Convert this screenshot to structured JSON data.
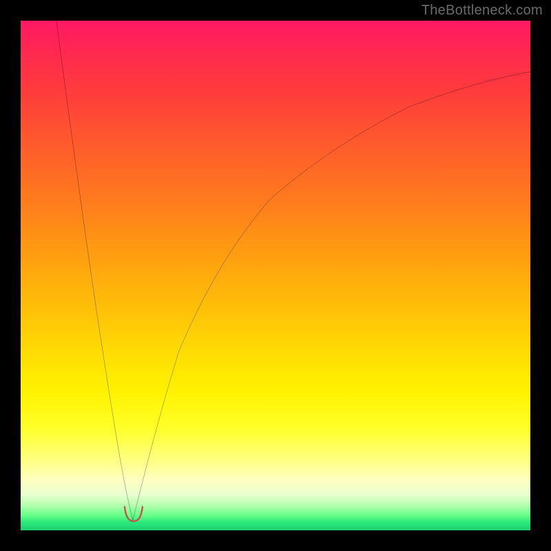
{
  "watermark": {
    "text": "TheBottleneck.com"
  },
  "colors": {
    "background": "#000000",
    "curve_main": "#000000",
    "marker": "#c1564e",
    "gradient_stops": [
      "#ff1864",
      "#ff2850",
      "#ff3c3c",
      "#ff5a2d",
      "#ff7a1e",
      "#ff9e10",
      "#ffbe08",
      "#ffdc04",
      "#fff300",
      "#ffff2a",
      "#ffff80",
      "#ffffc0",
      "#eaffd0",
      "#b8ffb0",
      "#6aff8a",
      "#28e87a",
      "#1cce70"
    ]
  },
  "chart_data": {
    "type": "line",
    "title": "",
    "xlabel": "",
    "ylabel": "",
    "xlim": [
      0,
      100
    ],
    "ylim": [
      0,
      100
    ],
    "grid": false,
    "legend": false,
    "annotations": [
      "TheBottleneck.com"
    ],
    "description": "Bottleneck-style V curve: a steep descent from upper-left to a minimum near x≈22, y≈2, then a slower rise toward the right edge. A short thick brick-red marker sits at the valley floor.",
    "series": [
      {
        "name": "left-branch",
        "x": [
          7,
          9,
          11,
          13,
          15,
          17,
          19,
          20.5,
          22
        ],
        "y": [
          100,
          85,
          70,
          56,
          42,
          29,
          17,
          9,
          2
        ]
      },
      {
        "name": "right-branch",
        "x": [
          22,
          24,
          27,
          31,
          36,
          42,
          49,
          57,
          66,
          76,
          87,
          100
        ],
        "y": [
          2,
          10,
          22,
          35,
          47,
          57,
          65,
          72,
          78,
          83,
          87,
          90
        ]
      },
      {
        "name": "valley-marker",
        "x": [
          20.5,
          21.2,
          22.2,
          23.2,
          23.8
        ],
        "y": [
          4.5,
          2.3,
          2.0,
          2.3,
          4.5
        ]
      }
    ]
  }
}
